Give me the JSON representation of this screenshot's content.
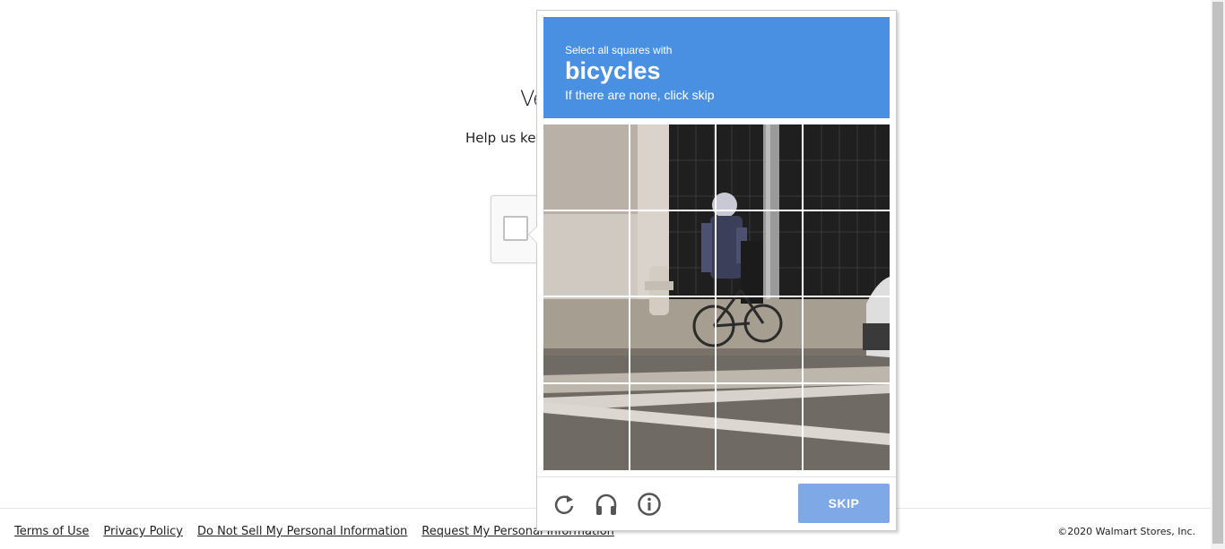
{
  "background": {
    "title": "Ve",
    "subtitle": "Help us kee"
  },
  "challenge": {
    "prompt_line1": "Select all squares with",
    "prompt_keyword": "bicycles",
    "prompt_line3": "If there are none, click skip",
    "skip_label": "SKIP",
    "colors": {
      "prompt_bg": "#4a90e2",
      "skip_bg": "#7ea9e6"
    },
    "icons": [
      "reload-icon",
      "audio-icon",
      "info-icon"
    ]
  },
  "footer": {
    "links": [
      "Terms of Use",
      "Privacy Policy",
      "Do Not Sell My Personal Information",
      "Request My Personal Information"
    ],
    "copyright": "©2020 Walmart Stores, Inc."
  }
}
